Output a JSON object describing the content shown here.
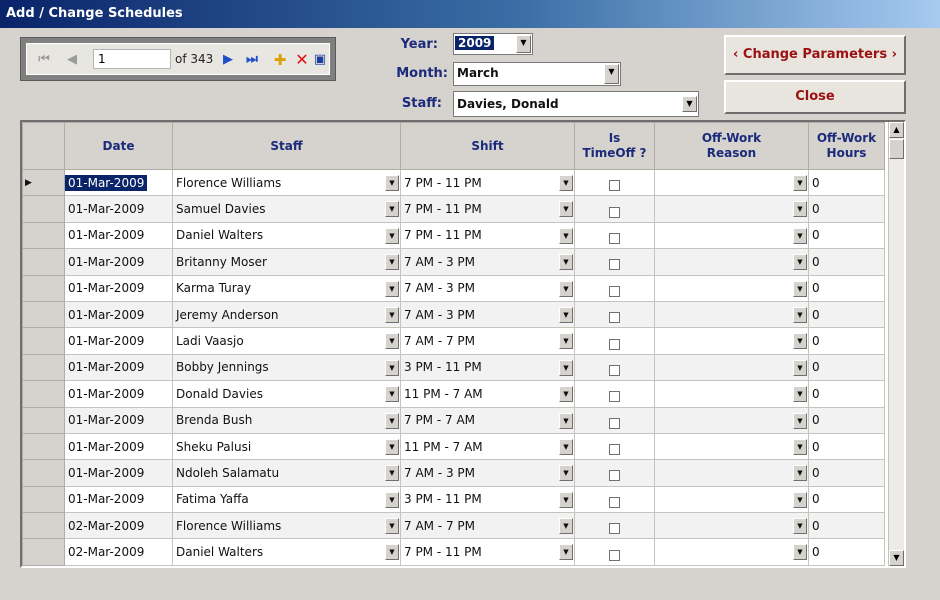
{
  "window": {
    "title": "Add / Change Schedules"
  },
  "navigator": {
    "position": "1",
    "of_text": "of 343"
  },
  "params": {
    "year_label": "Year:",
    "year_value": "2009",
    "month_label": "Month:",
    "month_value": "March",
    "staff_label": "Staff:",
    "staff_value": "Davies, Donald"
  },
  "buttons": {
    "change_params": "‹ Change Parameters ›",
    "close": "Close"
  },
  "grid": {
    "headers": [
      "Date",
      "Staff",
      "Shift",
      "Is\nTimeOff ?",
      "Off-Work\nReason",
      "Off-Work\nHours"
    ],
    "rows": [
      {
        "date": "01-Mar-2009",
        "staff": "Florence Williams",
        "shift": "7 PM - 11 PM",
        "reason": "",
        "hours": "0"
      },
      {
        "date": "01-Mar-2009",
        "staff": "Samuel Davies",
        "shift": "7 PM - 11 PM",
        "reason": "",
        "hours": "0"
      },
      {
        "date": "01-Mar-2009",
        "staff": "Daniel Walters",
        "shift": "7 PM - 11 PM",
        "reason": "",
        "hours": "0"
      },
      {
        "date": "01-Mar-2009",
        "staff": "Britanny Moser",
        "shift": "7 AM - 3 PM",
        "reason": "",
        "hours": "0"
      },
      {
        "date": "01-Mar-2009",
        "staff": "Karma Turay",
        "shift": "7 AM - 3 PM",
        "reason": "",
        "hours": "0"
      },
      {
        "date": "01-Mar-2009",
        "staff": "Jeremy Anderson",
        "shift": "7 AM - 3 PM",
        "reason": "",
        "hours": "0"
      },
      {
        "date": "01-Mar-2009",
        "staff": "Ladi Vaasjo",
        "shift": "7 AM - 7 PM",
        "reason": "",
        "hours": "0"
      },
      {
        "date": "01-Mar-2009",
        "staff": "Bobby Jennings",
        "shift": "3 PM - 11 PM",
        "reason": "",
        "hours": "0"
      },
      {
        "date": "01-Mar-2009",
        "staff": "Donald Davies",
        "shift": "11 PM - 7 AM",
        "reason": "",
        "hours": "0"
      },
      {
        "date": "01-Mar-2009",
        "staff": "Brenda Bush",
        "shift": "7 PM - 7 AM",
        "reason": "",
        "hours": "0"
      },
      {
        "date": "01-Mar-2009",
        "staff": "Sheku Palusi",
        "shift": "11 PM - 7 AM",
        "reason": "",
        "hours": "0"
      },
      {
        "date": "01-Mar-2009",
        "staff": "Ndoleh Salamatu",
        "shift": "7 AM - 3 PM",
        "reason": "",
        "hours": "0"
      },
      {
        "date": "01-Mar-2009",
        "staff": "Fatima Yaffa",
        "shift": "3 PM - 11 PM",
        "reason": "",
        "hours": "0"
      },
      {
        "date": "02-Mar-2009",
        "staff": "Florence Williams",
        "shift": "7 AM - 7 PM",
        "reason": "",
        "hours": "0"
      },
      {
        "date": "02-Mar-2009",
        "staff": "Daniel Walters",
        "shift": "7 PM - 11 PM",
        "reason": "",
        "hours": "0"
      }
    ]
  },
  "icons": {
    "first": "first-record-icon",
    "prev": "prev-record-icon",
    "next": "next-record-icon",
    "last": "last-record-icon",
    "new": "new-record-icon",
    "delete": "delete-record-icon",
    "save": "save-icon",
    "row_indicator": "current-row-arrow-icon"
  },
  "colors": {
    "title_start": "#0a246a",
    "title_end": "#a6caf0",
    "label_blue": "#1b2a7a",
    "button_red": "#9b1111",
    "selection": "#0a246a"
  }
}
